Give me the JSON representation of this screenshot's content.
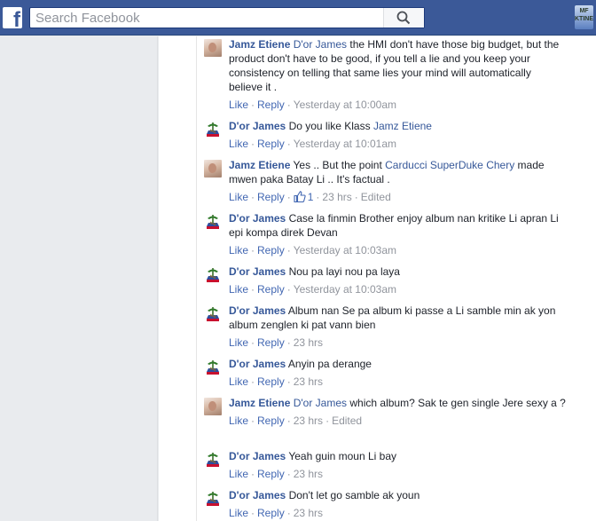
{
  "header": {
    "search_placeholder": "Search Facebook",
    "logo_letter": "f",
    "badge_text": "MF KTINE"
  },
  "ui_labels": {
    "like": "Like",
    "reply": "Reply",
    "separator": "·"
  },
  "comments": [
    {
      "avatar": "jamz",
      "author": "Jamz Etiene",
      "mention": "D'or James",
      "text": "the HMI don't have those big budget, but the product don't have to be good, if you tell a lie and you keep your consistency on telling that same lies your mind will automatically believe it .",
      "time": "Yesterday at 10:00am",
      "likes": "",
      "edited": ""
    },
    {
      "avatar": "dor",
      "author": "D'or James",
      "text": "Do you like Klass",
      "mention_after": "Jamz Etiene",
      "time": "Yesterday at 10:01am",
      "likes": "",
      "edited": ""
    },
    {
      "avatar": "jamz",
      "author": "Jamz Etiene",
      "text": "Yes .. But the point",
      "mention_after": "Carducci SuperDuke Chery",
      "text_after": "made mwen paka Batay Li .. It's factual .",
      "time": "23 hrs",
      "likes": "1",
      "edited": "Edited"
    },
    {
      "avatar": "dor",
      "author": "D'or James",
      "text": "Case la finmin Brother enjoy album nan kritike Li apran Li epi kompa direk Devan",
      "time": "Yesterday at 10:03am",
      "likes": "",
      "edited": ""
    },
    {
      "avatar": "dor",
      "author": "D'or James",
      "text": "Nou pa layi nou pa laya",
      "time": "Yesterday at 10:03am",
      "likes": "",
      "edited": ""
    },
    {
      "avatar": "dor",
      "author": "D'or James",
      "text": "Album nan Se pa album ki passe a Li samble min ak yon album zenglen ki pat vann bien",
      "time": "23 hrs",
      "likes": "",
      "edited": ""
    },
    {
      "avatar": "dor",
      "author": "D'or James",
      "text": "Anyin pa derange",
      "time": "23 hrs",
      "likes": "",
      "edited": ""
    },
    {
      "avatar": "jamz",
      "author": "Jamz Etiene",
      "mention": "D'or James",
      "text": "which album? Sak te gen single Jere sexy a ?",
      "time": "23 hrs",
      "likes": "",
      "edited": "Edited"
    },
    {
      "avatar": "dor",
      "author": "D'or James",
      "text": "Yeah guin moun Li bay",
      "time": "23 hrs",
      "likes": "",
      "edited": ""
    },
    {
      "avatar": "dor",
      "author": "D'or James",
      "text": "Don't let go samble ak youn",
      "time": "23 hrs",
      "likes": "",
      "edited": ""
    }
  ],
  "colors": {
    "topbar": "#3b5998",
    "link": "#365899",
    "meta": "#90949c"
  }
}
